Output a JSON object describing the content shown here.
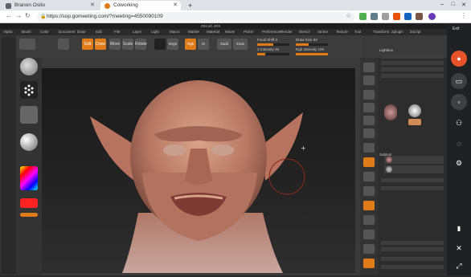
{
  "browser": {
    "tabs": [
      {
        "label": "Branon Osito",
        "favicon_color": "#5f6368"
      },
      {
        "label": "Coworking",
        "favicon_color": "#e07b1a"
      }
    ],
    "url": "https://sop.gomeeting.com/?meeting=4550090109"
  },
  "zbrush": {
    "title_bar": "ZBrush 4R8",
    "menu": [
      "Alpha",
      "Brush",
      "Color",
      "Document",
      "Draw",
      "Edit",
      "File",
      "Layer",
      "Light",
      "Macro",
      "Marker",
      "Material",
      "Movie",
      "Picker",
      "Preferences",
      "Render",
      "Stencil",
      "Stroke",
      "Texture",
      "Tool",
      "Transform",
      "Zplugin",
      "Zscript"
    ],
    "toolbar": {
      "edit_label": "Edit",
      "draw_label": "Draw",
      "move_label": "Move",
      "scale_label": "Scale",
      "rotate_label": "Rotate",
      "mrgb_label": "Mrgb",
      "rgb_label": "Rgb",
      "m_label": "M",
      "zadd_label": "Zadd",
      "zsub_label": "Zsub",
      "focal_label": "Focal Shift 0",
      "draw_size_label": "Draw Size 64",
      "z_intensity_label": "Z Intensity 25",
      "rgb_intensity_label": "Rgb Intensity 100"
    },
    "right_panel": {
      "header": "Lightbox",
      "subtools_label": "Subtool",
      "tool_label": "Tool"
    }
  },
  "meet": {
    "exit_label": "Exit",
    "accent": "#e8542a"
  }
}
